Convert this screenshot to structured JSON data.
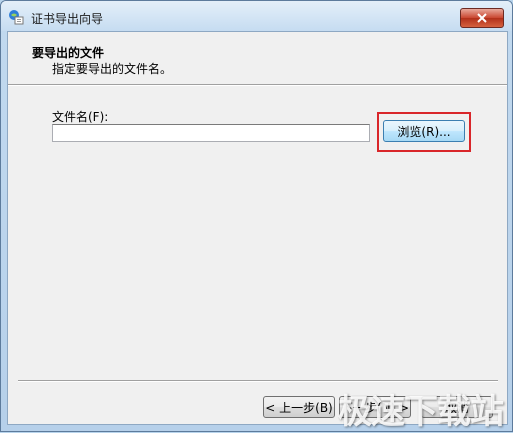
{
  "window": {
    "title": "证书导出向导"
  },
  "header": {
    "title": "要导出的文件",
    "subtitle": "指定要导出的文件名。"
  },
  "form": {
    "file_label": "文件名(F):",
    "file_value": "",
    "browse_label": "浏览(R)..."
  },
  "footer": {
    "back_label": "< 上一步(B)",
    "next_label": "下一步(N) >",
    "cancel_label": "取消"
  },
  "watermark": {
    "text": "极速下载站"
  },
  "colors": {
    "highlight": "#d9262a",
    "close_button": "#c9452f"
  },
  "icons": {
    "app": "certificate-icon",
    "close": "close-icon"
  }
}
